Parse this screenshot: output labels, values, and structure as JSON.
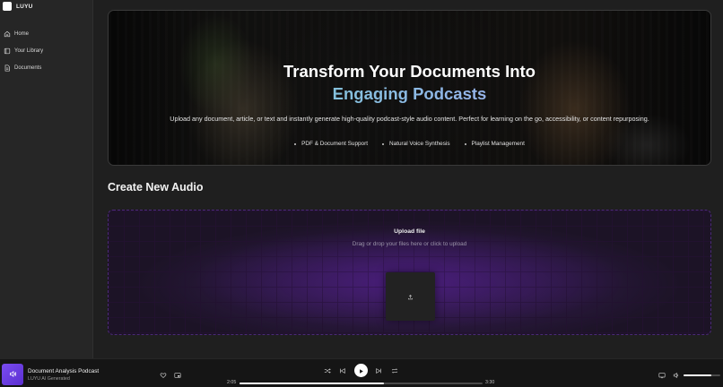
{
  "app": {
    "name": "LUYU"
  },
  "sidebar": {
    "items": [
      {
        "label": "Home",
        "icon": "home-icon"
      },
      {
        "label": "Your Library",
        "icon": "library-icon"
      },
      {
        "label": "Documents",
        "icon": "document-icon"
      }
    ]
  },
  "hero": {
    "title": "Transform Your Documents Into",
    "title_accent": "Engaging Podcasts",
    "description": "Upload any document, article, or text and instantly generate high-quality podcast-style audio content. Perfect for learning on the go, accessibility, or content repurposing.",
    "features": [
      "PDF & Document Support",
      "Natural Voice Synthesis",
      "Playlist Management"
    ]
  },
  "create": {
    "title": "Create New Audio",
    "upload_title": "Upload file",
    "upload_subtitle": "Drag or drop your files here or click to upload"
  },
  "player": {
    "track_title": "Document Analysis Podcast",
    "track_subtitle": "LUYU AI Generated",
    "time_current": "2:05",
    "time_total": "3:30",
    "progress": 0.595,
    "volume": 0.75
  },
  "colors": {
    "accent_purple": "#7a4cf0",
    "gradient_start": "#6ed3c0",
    "gradient_end": "#b79cf0"
  }
}
